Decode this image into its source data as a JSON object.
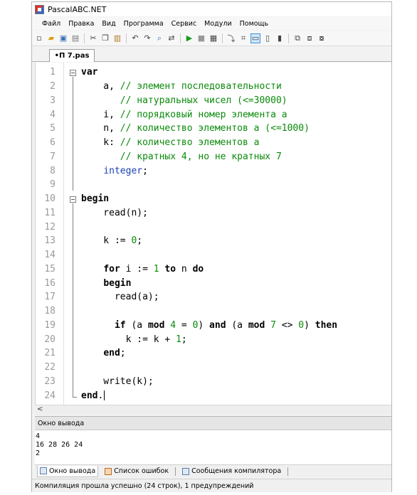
{
  "window": {
    "title": "PascalABC.NET"
  },
  "menu": [
    "Файл",
    "Правка",
    "Вид",
    "Программа",
    "Сервис",
    "Модули",
    "Помощь"
  ],
  "toolbar_icons": [
    "new-file-icon",
    "open-file-icon",
    "save-icon",
    "save-all-icon",
    "cut-icon",
    "copy-icon",
    "paste-icon",
    "undo-icon",
    "redo-icon",
    "find-icon",
    "replace-icon",
    "run-icon",
    "stop-icon",
    "debug-icon",
    "step-icon",
    "watch-icon",
    "format-icon",
    "toggle-output-icon",
    "navigate-icon",
    "compile-icon",
    "new-window-icon",
    "settings-icon"
  ],
  "editor": {
    "tab_label": "•П 7.pas",
    "lines": [
      {
        "n": "1",
        "text": "var"
      },
      {
        "n": "2",
        "text": "    a, // элемент последовательности"
      },
      {
        "n": "3",
        "text": "       // натуральных чисел (<=30000)"
      },
      {
        "n": "4",
        "text": "    i, // порядковый номер элемента a"
      },
      {
        "n": "5",
        "text": "    n, // количество элементов a (<=1000)"
      },
      {
        "n": "6",
        "text": "    k: // количество элементов a"
      },
      {
        "n": "7",
        "text": "       // кратных 4, но не кратных 7"
      },
      {
        "n": "8",
        "text": "    integer;"
      },
      {
        "n": "9",
        "text": ""
      },
      {
        "n": "10",
        "text": "begin"
      },
      {
        "n": "11",
        "text": "    read(n);"
      },
      {
        "n": "12",
        "text": ""
      },
      {
        "n": "13",
        "text": "    k := 0;"
      },
      {
        "n": "14",
        "text": ""
      },
      {
        "n": "15",
        "text": "    for i := 1 to n do"
      },
      {
        "n": "16",
        "text": "    begin"
      },
      {
        "n": "17",
        "text": "      read(a);"
      },
      {
        "n": "18",
        "text": ""
      },
      {
        "n": "19",
        "text": "      if (a mod 4 = 0) and (a mod 7 <> 0) then"
      },
      {
        "n": "20",
        "text": "        k := k + 1;"
      },
      {
        "n": "21",
        "text": "    end;"
      },
      {
        "n": "22",
        "text": ""
      },
      {
        "n": "23",
        "text": "    write(k);"
      },
      {
        "n": "24",
        "text": "end."
      }
    ]
  },
  "output": {
    "header": "Окно вывода",
    "lines": [
      "4",
      "16 28 26 24",
      "2"
    ]
  },
  "bottom_tabs": [
    "Окно вывода",
    "Список ошибок",
    "Сообщения компилятора"
  ],
  "status": "Компиляция прошла успешно (24 строк), 1 предупреждений",
  "colors": {
    "keyword": "#000000",
    "type": "#1b3fb5",
    "comment": "#0a8a0a",
    "number": "#0a8a0a",
    "selection": "#cfe6fb"
  }
}
